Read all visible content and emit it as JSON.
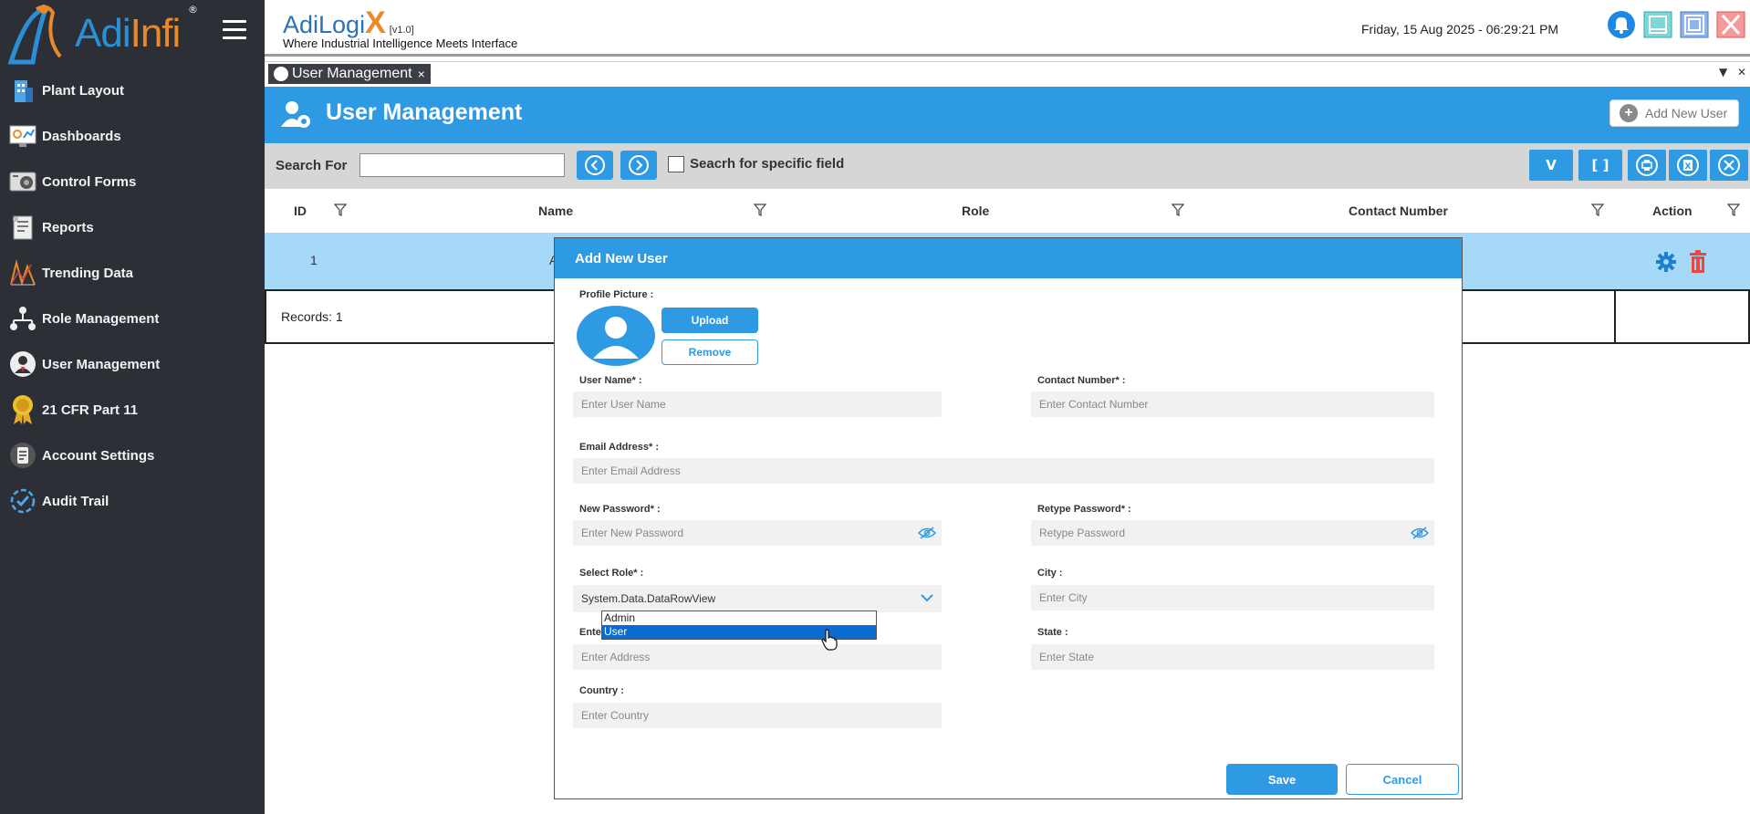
{
  "app": {
    "logo_text_blue": "Adi",
    "logo_text_orange": "Infi",
    "logo_reg": "®",
    "brand_main": "AdiLogi",
    "brand_x": "X",
    "version": "[v1.0]",
    "tagline": "Where Industrial Intelligence Meets Interface",
    "datetime": "Friday, 15 Aug 2025 - 06:29:21 PM"
  },
  "sidebar": {
    "items": [
      {
        "label": "Plant Layout",
        "icon": "building-icon"
      },
      {
        "label": "Dashboards",
        "icon": "dashboard-icon"
      },
      {
        "label": "Control Forms",
        "icon": "control-forms-icon"
      },
      {
        "label": "Reports",
        "icon": "reports-icon"
      },
      {
        "label": "Trending Data",
        "icon": "trend-icon"
      },
      {
        "label": "Role Management",
        "icon": "hierarchy-icon"
      },
      {
        "label": "User Management",
        "icon": "user-icon"
      },
      {
        "label": "21 CFR Part 11",
        "icon": "award-icon"
      },
      {
        "label": "Account Settings",
        "icon": "account-settings-icon"
      },
      {
        "label": "Audit Trail",
        "icon": "audit-icon"
      }
    ]
  },
  "tab": {
    "label": "User Management",
    "close": "×"
  },
  "strip": {
    "dropdown": "▼",
    "close": "✕"
  },
  "page": {
    "title": "User Management",
    "add_button": "Add New User"
  },
  "search": {
    "label": "Search For",
    "value": "",
    "specific_label": "Seacrh for specific field"
  },
  "toolbar": {
    "v_label": "V",
    "brackets_label": "[ ]"
  },
  "grid": {
    "columns": [
      "ID",
      "Name",
      "Role",
      "Contact Number",
      "Action"
    ],
    "rows": [
      {
        "id": "1",
        "name": "A"
      }
    ],
    "records_label": "Records: 1"
  },
  "dialog": {
    "title": "Add New User",
    "profile_label": "Profile Picture :",
    "upload_label": "Upload",
    "remove_label": "Remove",
    "username_label": "User Name* :",
    "username_placeholder": "Enter User Name",
    "contact_label": "Contact Number* :",
    "contact_placeholder": "Enter Contact Number",
    "email_label": "Email Address* :",
    "email_placeholder": "Enter Email Address",
    "newpass_label": "New Password* :",
    "newpass_placeholder": "Enter New Password",
    "retype_label": "Retype Password* :",
    "retype_placeholder": "Retype Password",
    "role_label": "Select Role* :",
    "role_value": "System.Data.DataRowView",
    "role_options": [
      "Admin",
      "User"
    ],
    "role_highlighted": "User",
    "city_label": "City :",
    "city_placeholder": "Enter City",
    "address_label": "Enter",
    "address_placeholder": "Enter Address",
    "state_label": "State :",
    "state_placeholder": "Enter State",
    "country_label": "Country :",
    "country_placeholder": "Enter Country",
    "save_label": "Save",
    "cancel_label": "Cancel"
  },
  "colors": {
    "accent": "#2f9ae4",
    "sidebar_bg": "#2c2f36",
    "row_highlight": "#a6d8f7",
    "delete_red": "#e84a3f",
    "brand_orange": "#e8892b"
  }
}
